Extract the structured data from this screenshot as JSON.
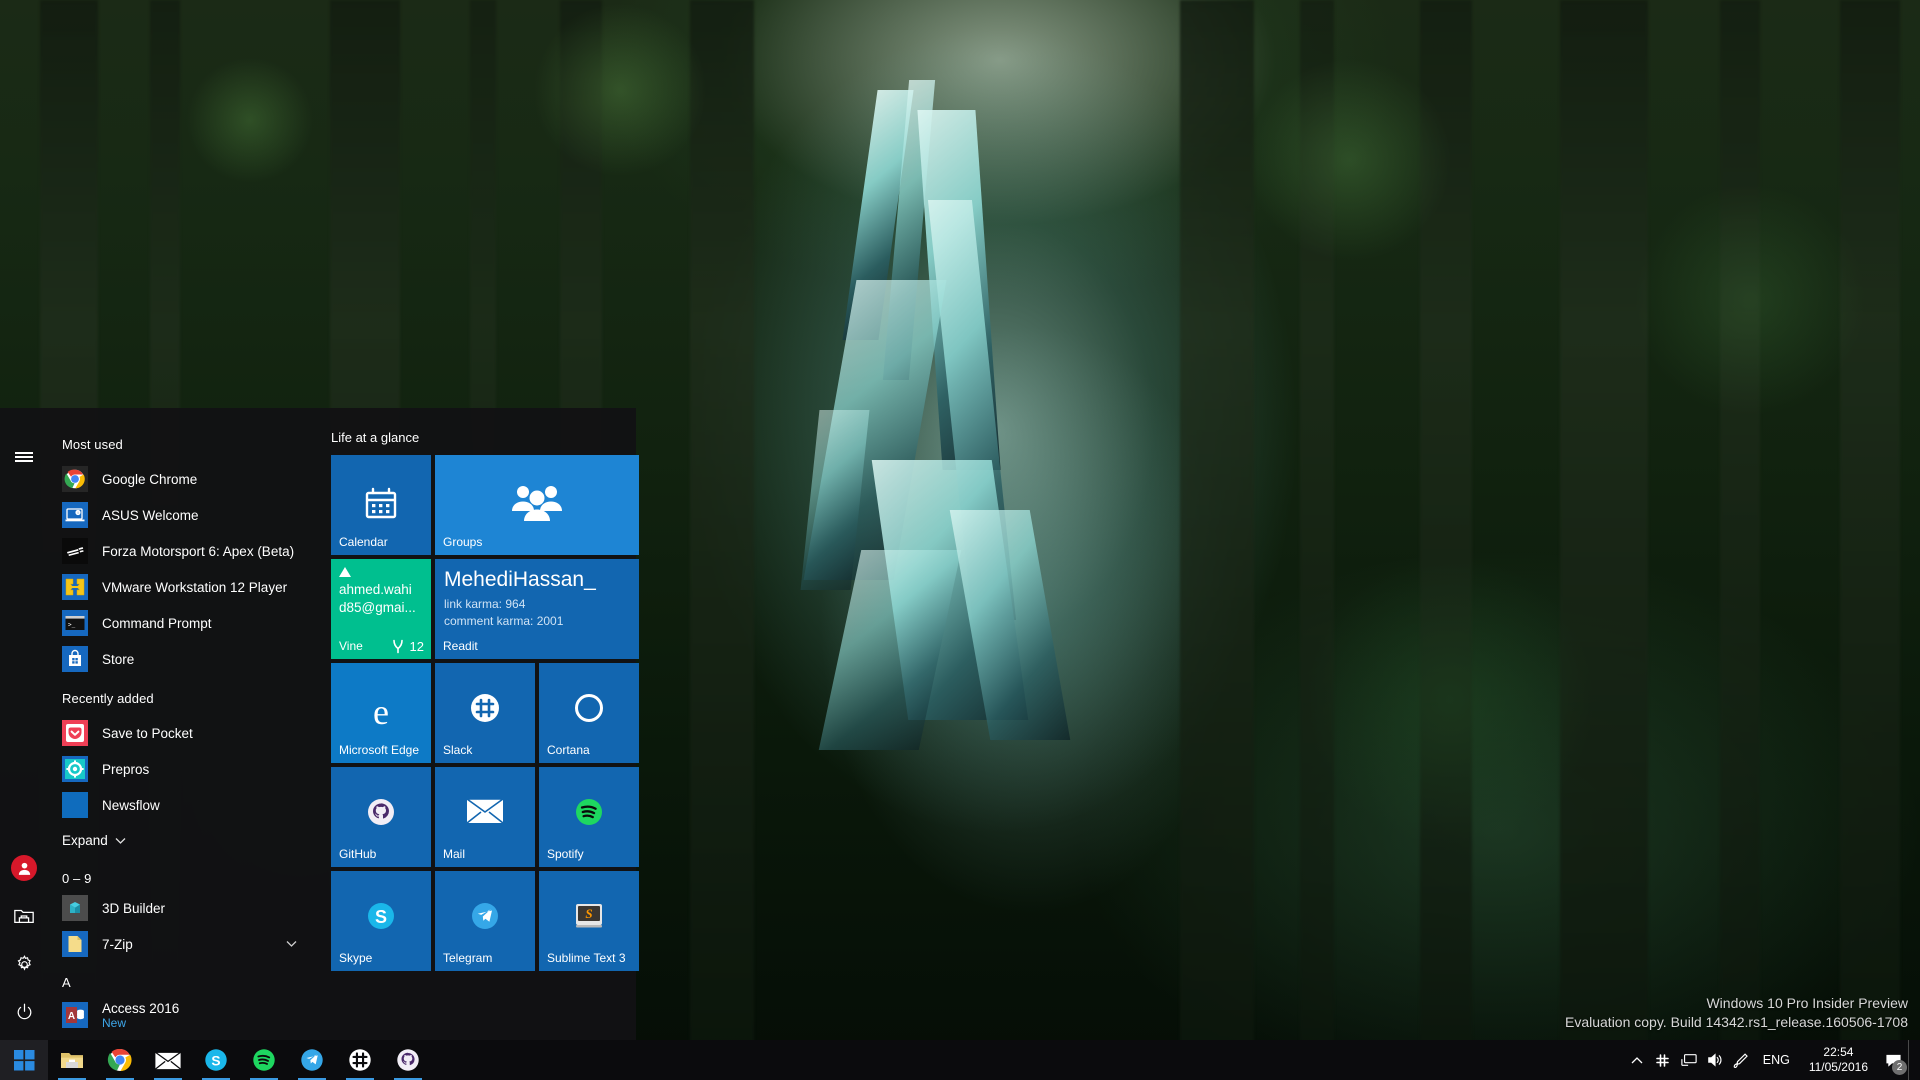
{
  "desktop": {
    "watermark_line1": "Windows 10 Pro Insider Preview",
    "watermark_line2": "Evaluation copy. Build 14342.rs1_release.160506-1708"
  },
  "start_menu": {
    "rail": {
      "hamburger_label": "Menu",
      "account_name": "user-account",
      "file_explorer_label": "File Explorer",
      "settings_label": "Settings",
      "power_label": "Power"
    },
    "app_list": {
      "most_used_title": "Most used",
      "most_used": [
        {
          "label": "Google Chrome",
          "icon": "chrome-icon"
        },
        {
          "label": "ASUS Welcome",
          "icon": "asus-welcome-icon"
        },
        {
          "label": "Forza Motorsport 6: Apex (Beta)",
          "icon": "forza-icon"
        },
        {
          "label": "VMware Workstation 12 Player",
          "icon": "vmware-icon"
        },
        {
          "label": "Command Prompt",
          "icon": "command-prompt-icon"
        },
        {
          "label": "Store",
          "icon": "store-icon"
        }
      ],
      "recently_added_title": "Recently added",
      "recently_added": [
        {
          "label": "Save to Pocket",
          "icon": "pocket-icon"
        },
        {
          "label": "Prepros",
          "icon": "prepros-icon"
        },
        {
          "label": "Newsflow",
          "icon": "newsflow-icon"
        }
      ],
      "expand_label": "Expand",
      "groups": [
        {
          "header": "0 – 9",
          "items": [
            {
              "label": "3D Builder",
              "icon": "3d-builder-icon",
              "sub": "",
              "chevron": false
            },
            {
              "label": "7-Zip",
              "icon": "sevenzip-icon",
              "sub": "",
              "chevron": true
            }
          ]
        },
        {
          "header": "A",
          "items": [
            {
              "label": "Access 2016",
              "icon": "access-icon",
              "sub": "New",
              "chevron": false
            }
          ]
        }
      ]
    },
    "tiles": {
      "group_title": "Life at a glance",
      "items": [
        {
          "name": "Calendar",
          "icon": "calendar-icon",
          "size": "medium",
          "color": "#1266b0"
        },
        {
          "name": "Groups",
          "icon": "groups-icon",
          "size": "wide",
          "color": "#1e85d4"
        },
        {
          "name": "Vine",
          "icon": "vine-icon",
          "size": "medium",
          "color": "#00bf8f",
          "live": {
            "line1": "ahmed.wahi",
            "line2": "d85@gmai...",
            "badge": "12"
          }
        },
        {
          "name": "Readit",
          "icon": "readit-icon",
          "size": "wide",
          "color": "#1266b0",
          "live": {
            "title": "MehediHassan_",
            "line1": "link karma: 964",
            "line2": "comment karma: 2001"
          }
        },
        {
          "name": "Microsoft Edge",
          "icon": "edge-icon",
          "size": "medium",
          "color": "#0d7ac6"
        },
        {
          "name": "Slack",
          "icon": "slack-icon",
          "size": "medium",
          "color": "#1266b0"
        },
        {
          "name": "Cortana",
          "icon": "cortana-icon",
          "size": "medium",
          "color": "#1266b0"
        },
        {
          "name": "GitHub",
          "icon": "github-icon",
          "size": "medium",
          "color": "#1266b0"
        },
        {
          "name": "Mail",
          "icon": "mail-icon",
          "size": "medium",
          "color": "#1266b0"
        },
        {
          "name": "Spotify",
          "icon": "spotify-icon",
          "size": "medium",
          "color": "#1266b0"
        },
        {
          "name": "Skype",
          "icon": "skype-icon",
          "size": "medium",
          "color": "#1266b0"
        },
        {
          "name": "Telegram",
          "icon": "telegram-icon",
          "size": "medium",
          "color": "#1266b0"
        },
        {
          "name": "Sublime Text 3",
          "icon": "sublime-icon",
          "size": "medium",
          "color": "#1266b0"
        }
      ]
    }
  },
  "taskbar": {
    "start_label": "Start",
    "pinned": [
      {
        "name": "File Explorer",
        "icon": "file-explorer-icon",
        "running": true
      },
      {
        "name": "Google Chrome",
        "icon": "chrome-icon",
        "running": true
      },
      {
        "name": "Mail",
        "icon": "mail-icon",
        "running": true
      },
      {
        "name": "Skype",
        "icon": "skype-icon",
        "running": true
      },
      {
        "name": "Spotify",
        "icon": "spotify-icon",
        "running": true
      },
      {
        "name": "Telegram",
        "icon": "telegram-icon",
        "running": true
      },
      {
        "name": "Slack",
        "icon": "slack-icon",
        "running": true
      },
      {
        "name": "GitHub",
        "icon": "github-icon",
        "running": true
      }
    ],
    "tray": {
      "show_hidden_label": "Show hidden icons",
      "slack_label": "Slack",
      "network_label": "Network",
      "volume_label": "Volume",
      "pen_label": "Windows Ink Workspace",
      "language": "ENG",
      "time": "22:54",
      "date": "11/05/2016",
      "action_center_label": "Action Center",
      "action_center_badge": "2"
    }
  },
  "colors": {
    "accent": "#1266b0",
    "tile_light": "#1e85d4",
    "vine_green": "#00bf8f",
    "taskbar": "#0b0b0d",
    "menu_bg": "#121214",
    "new_badge": "#3ea6e8"
  }
}
